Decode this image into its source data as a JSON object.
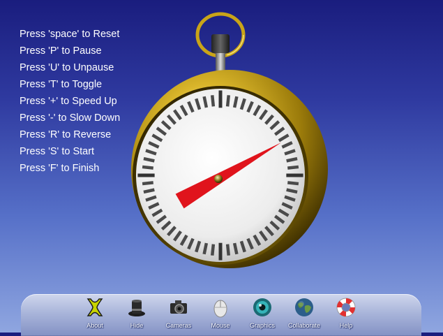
{
  "instructions": [
    "Press 'space' to Reset",
    "Press 'P' to Pause",
    "Press 'U' to Unpause",
    "Press 'T' to Toggle",
    "Press '+' to Speed Up",
    "Press '-' to Slow Down",
    "Press 'R' to Reverse",
    "Press 'S' to Start",
    "Press 'F' to Finish"
  ],
  "stopwatch": {
    "hand_seconds": 10,
    "colors": {
      "gold": "#c8a418",
      "dial": "#f2f2f2",
      "hand": "#e0141c",
      "ticks": "#444444"
    }
  },
  "toolbar": {
    "buttons": [
      {
        "label": "About",
        "icon": "about-icon"
      },
      {
        "label": "Hide",
        "icon": "hide-top-hat-icon"
      },
      {
        "label": "Cameras",
        "icon": "camera-icon"
      },
      {
        "label": "Mouse",
        "icon": "mouse-icon"
      },
      {
        "label": "Graphics",
        "icon": "eye-icon"
      },
      {
        "label": "Collaborate",
        "icon": "globe-icon"
      },
      {
        "label": "Help",
        "icon": "lifebuoy-icon"
      }
    ]
  }
}
